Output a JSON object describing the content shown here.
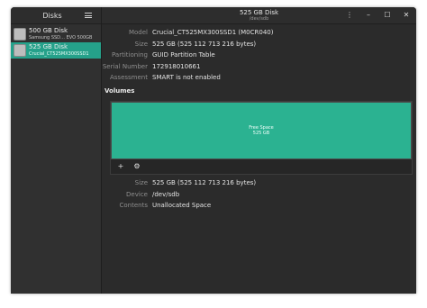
{
  "sidebar": {
    "title": "Disks",
    "disks": [
      {
        "name": "500 GB Disk",
        "model": "Samsung SSD… EVO 500GB"
      },
      {
        "name": "525 GB Disk",
        "model": "Crucial_CT525MX300SSD1"
      }
    ]
  },
  "titlebar": {
    "title": "525 GB Disk",
    "subtitle": "/dev/sdb",
    "menu_glyph": "⋮",
    "minimize_glyph": "–",
    "maximize_glyph": "☐",
    "close_glyph": "✕"
  },
  "disk_info": [
    {
      "label": "Model",
      "value": "Crucial_CT525MX300SSD1 (M0CR040)"
    },
    {
      "label": "Size",
      "value": "525 GB (525 112 713 216 bytes)"
    },
    {
      "label": "Partitioning",
      "value": "GUID Partition Table"
    },
    {
      "label": "Serial Number",
      "value": "172918010661"
    },
    {
      "label": "Assessment",
      "value": "SMART is not enabled"
    }
  ],
  "volumes": {
    "title": "Volumes",
    "block": {
      "line1": "Free Space",
      "line2": "525 GB"
    },
    "add_glyph": "+",
    "settings_glyph": "⚙"
  },
  "volume_info": [
    {
      "label": "Size",
      "value": "525 GB (525 112 713 216 bytes)"
    },
    {
      "label": "Device",
      "value": "/dev/sdb"
    },
    {
      "label": "Contents",
      "value": "Unallocated Space"
    }
  ],
  "colors": {
    "accent": "#25a18a",
    "volume": "#2bb291",
    "background": "#2b2b2b"
  }
}
